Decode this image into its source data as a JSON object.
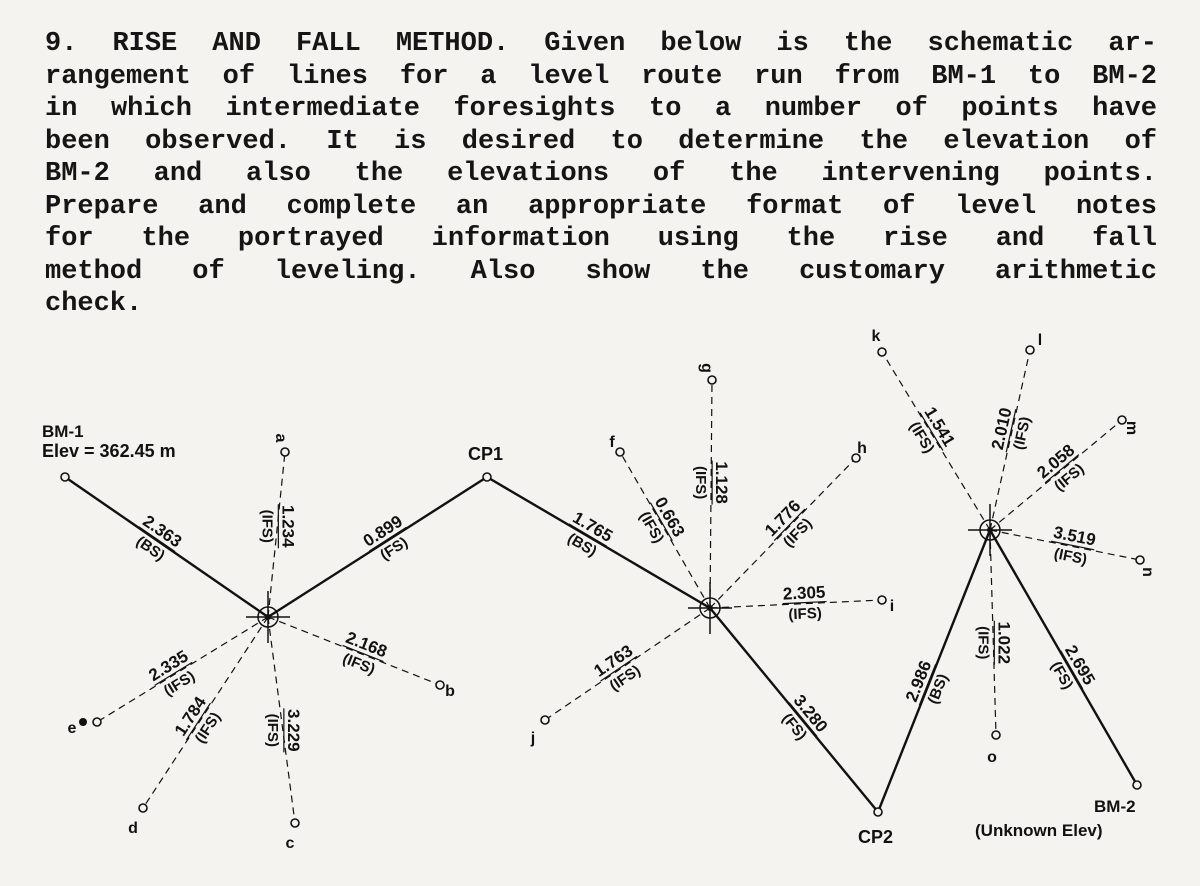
{
  "problem": {
    "lines": [
      "9. RISE AND FALL METHOD. Given below is the schematic ar-",
      "rangement of lines for a level route run from BM-1 to BM-2",
      "in which intermediate foresights to a number of points have",
      "been observed. It is desired to determine the elevation of",
      "BM-2 and also the elevations of the intervening points.",
      "Prepare and complete an appropriate format of level notes",
      "for the portrayed information using the rise and fall",
      "method of leveling. Also show the customary arithmetic",
      "check."
    ]
  },
  "diagram": {
    "bm1_label": "BM-1",
    "bm1_elev": "Elev = 362.45 m",
    "cp1_label": "CP1",
    "cp2_label": "CP2",
    "bm2_label": "BM-2",
    "bm2_note": "(Unknown Elev)",
    "shots": [
      {
        "setup": 1,
        "to": "BM1",
        "reading": "2.363",
        "type": "(BS)",
        "line": "solid"
      },
      {
        "setup": 1,
        "to": "a",
        "reading": "1.234",
        "type": "(IFS)",
        "line": "dashed"
      },
      {
        "setup": 1,
        "to": "CP1",
        "reading": "0.899",
        "type": "(FS)",
        "line": "solid"
      },
      {
        "setup": 1,
        "to": "b",
        "reading": "2.168",
        "type": "(IFS)",
        "line": "dashed"
      },
      {
        "setup": 1,
        "to": "c",
        "reading": "3.229",
        "type": "(IFS)",
        "line": "dashed"
      },
      {
        "setup": 1,
        "to": "d",
        "reading": "1.784",
        "type": "(IFS)",
        "line": "dashed"
      },
      {
        "setup": 1,
        "to": "e",
        "reading": "2.335",
        "type": "(IFS)",
        "line": "dashed"
      },
      {
        "setup": 2,
        "to": "CP1",
        "reading": "1.765",
        "type": "(BS)",
        "line": "solid"
      },
      {
        "setup": 2,
        "to": "f",
        "reading": "0.663",
        "type": "(IFS)",
        "line": "dashed"
      },
      {
        "setup": 2,
        "to": "g",
        "reading": "1.128",
        "type": "(IFS)",
        "line": "dashed"
      },
      {
        "setup": 2,
        "to": "h",
        "reading": "1.776",
        "type": "(IFS)",
        "line": "dashed"
      },
      {
        "setup": 2,
        "to": "i",
        "reading": "2.305",
        "type": "(IFS)",
        "line": "dashed"
      },
      {
        "setup": 2,
        "to": "j",
        "reading": "1.763",
        "type": "(IFS)",
        "line": "dashed"
      },
      {
        "setup": 2,
        "to": "CP2",
        "reading": "3.280",
        "type": "(FS)",
        "line": "solid"
      },
      {
        "setup": 3,
        "to": "CP2",
        "reading": "2.986",
        "type": "(BS)",
        "line": "solid"
      },
      {
        "setup": 3,
        "to": "k",
        "reading": "1.541",
        "type": "(IFS)",
        "line": "dashed"
      },
      {
        "setup": 3,
        "to": "l",
        "reading": "2.010",
        "type": "(IFS)",
        "line": "dashed"
      },
      {
        "setup": 3,
        "to": "m",
        "reading": "2.058",
        "type": "(IFS)",
        "line": "dashed"
      },
      {
        "setup": 3,
        "to": "n",
        "reading": "3.519",
        "type": "(IFS)",
        "line": "dashed"
      },
      {
        "setup": 3,
        "to": "o",
        "reading": "1.022",
        "type": "(IFS)",
        "line": "dashed"
      },
      {
        "setup": 3,
        "to": "BM2",
        "reading": "2.695",
        "type": "(FS)",
        "line": "solid"
      }
    ],
    "point_letters": [
      "a",
      "b",
      "c",
      "d",
      "e",
      "f",
      "g",
      "h",
      "i",
      "j",
      "k",
      "l",
      "m",
      "n",
      "o"
    ]
  }
}
